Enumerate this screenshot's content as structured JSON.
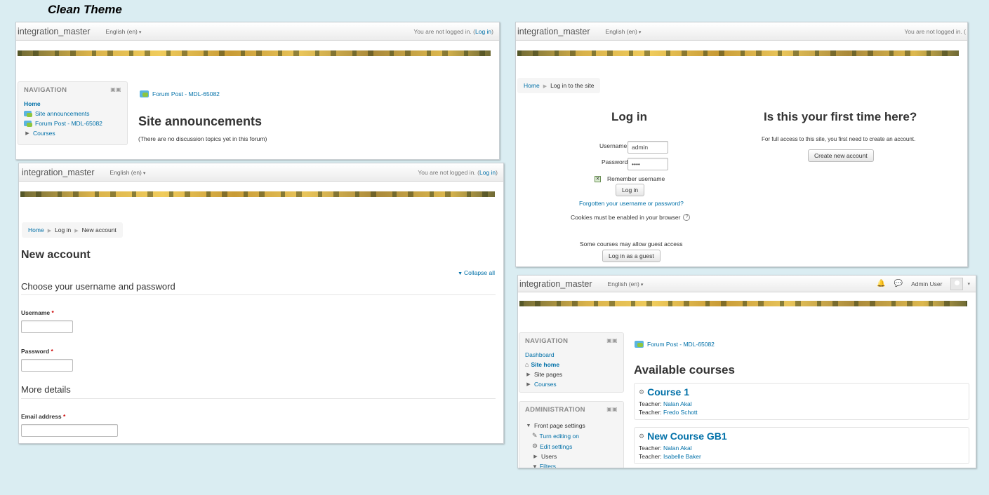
{
  "caption": "Clean Theme",
  "common": {
    "brand": "integration_master",
    "language": "English (en)",
    "not_logged": "You are not logged in. (",
    "login_link": "Log in",
    "close_paren": ")",
    "home": "Home"
  },
  "forum_page": {
    "nav_title": "NAVIGATION",
    "nav_items": [
      "Home",
      "Site announcements",
      "Forum Post - MDL-65082",
      "Courses"
    ],
    "post_link": "Forum Post - MDL-65082",
    "heading": "Site announcements",
    "empty_text": "(There are no discussion topics yet in this forum)"
  },
  "login_page": {
    "breadcrumb": [
      "Home",
      "Log in to the site"
    ],
    "heading": "Log in",
    "username_label": "Username",
    "username_value": "admin",
    "password_label": "Password",
    "password_value": "••••",
    "remember_label": "Remember username",
    "login_button": "Log in",
    "forgot_link": "Forgotten your username or password?",
    "cookies_text": "Cookies must be enabled in your browser",
    "guest_text": "Some courses may allow guest access",
    "guest_button": "Log in as a guest",
    "first_time_heading": "Is this your first time here?",
    "first_time_text": "For full access to this site, you first need to create an account.",
    "create_button": "Create new account"
  },
  "signup_page": {
    "breadcrumb": [
      "Home",
      "Log in",
      "New account"
    ],
    "heading": "New account",
    "collapse_all": "Collapse all",
    "section1": "Choose your username and password",
    "username_label": "Username",
    "password_label": "Password",
    "section2": "More details",
    "email_label": "Email address",
    "required_mark": "*"
  },
  "courses_page": {
    "user_name": "Admin User",
    "nav_title": "NAVIGATION",
    "nav_items": [
      "Dashboard",
      "Site home",
      "Site pages",
      "Courses"
    ],
    "admin_title": "ADMINISTRATION",
    "admin_items": [
      "Front page settings",
      "Turn editing on",
      "Edit settings",
      "Users",
      "Filters"
    ],
    "post_link": "Forum Post - MDL-65082",
    "heading": "Available courses",
    "courses": [
      {
        "name": "Course 1",
        "teacher_label": "Teacher: ",
        "teachers": [
          "Nalan Akal",
          "Fredo Schott"
        ]
      },
      {
        "name": "New Course GB1",
        "teacher_label": "Teacher: ",
        "teachers": [
          "Nalan Akal",
          "Isabelle Baker"
        ]
      }
    ]
  },
  "colors": {
    "background": "#daedf2",
    "link": "#0070a8",
    "required": "#cc0000"
  }
}
